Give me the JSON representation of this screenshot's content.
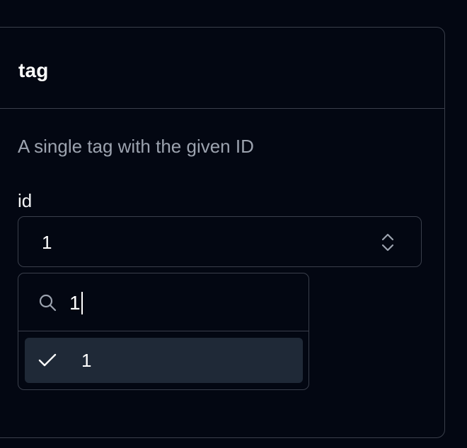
{
  "card": {
    "title": "tag",
    "description": "A single tag with the given ID"
  },
  "field": {
    "label": "id",
    "selected_value": "1",
    "icon": "chevrons-up-down-icon"
  },
  "dropdown": {
    "search_value": "1",
    "search_icon": "search-icon",
    "options": [
      {
        "label": "1",
        "selected": true,
        "icon": "check-icon"
      }
    ]
  },
  "colors": {
    "background": "#030712",
    "border": "#3a3f4b",
    "muted_text": "#9ca3af",
    "option_highlight": "#1f2937"
  }
}
